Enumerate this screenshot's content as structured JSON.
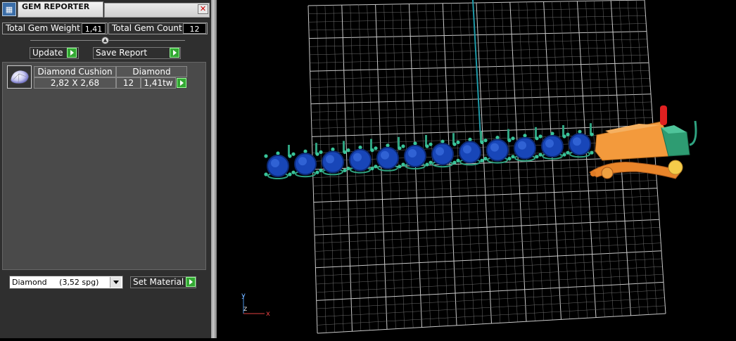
{
  "window": {
    "title": "GEM REPORTER",
    "close_glyph": "✕"
  },
  "summary": {
    "weight_label": "Total Gem Weight",
    "weight_value": "1,41",
    "count_label": "Total Gem Count",
    "count_value": "12"
  },
  "toolbar": {
    "update_label": "Update",
    "save_label": "Save Report"
  },
  "gem_list": [
    {
      "name": "Diamond Cushion",
      "material": "Diamond",
      "size": "2,82 X 2,68",
      "count": "12",
      "weight": "1,41tw"
    }
  ],
  "material_select": {
    "selected": "Diamond     (3,52 spg)",
    "button_label": "Set Material"
  },
  "axis": {
    "y": "y",
    "z": "z",
    "x": "x"
  },
  "icons": {
    "app": "gem-reporter-icon",
    "close": "close-icon",
    "arrow": "green-play-arrow-icon",
    "gem": "cushion-gem-icon",
    "dropdown": "chevron-down-icon",
    "slider": "slider-knob-icon"
  },
  "colors": {
    "panel_bg": "#2f2f2f",
    "list_bg": "#4a4a4a",
    "accent_green": "#33a833",
    "viewport_bg": "#000000",
    "grid": "#bdbdbd",
    "gem_blue": "#1846b8",
    "prong_teal": "#2fa381",
    "tool_orange": "#f0a040"
  }
}
